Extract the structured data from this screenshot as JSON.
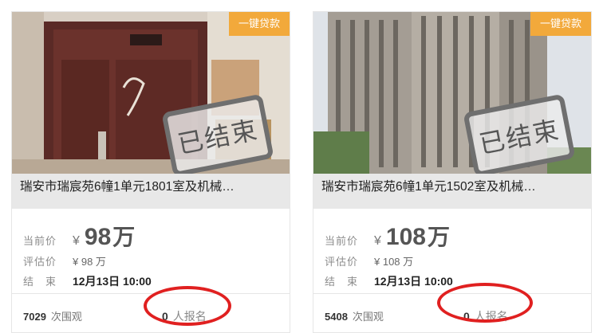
{
  "listings": [
    {
      "tag": "一键贷款",
      "stamp": "已结束",
      "title": "瑞安市瑞宸苑6幢1单元1801室及机械…",
      "price_label": "当前价",
      "price_yen": "¥",
      "price_value": "98",
      "price_unit": "万",
      "estimate_label": "评估价",
      "estimate_value": "¥ 98 万",
      "end_label": "结　束",
      "end_value": "12月13日 10:00",
      "views_count": "7029",
      "views_label": "次围观",
      "enroll_count": "0",
      "enroll_label": "人报名"
    },
    {
      "tag": "一键贷款",
      "stamp": "已结束",
      "title": "瑞安市瑞宸苑6幢1单元1502室及机械…",
      "price_label": "当前价",
      "price_yen": "¥",
      "price_value": "108",
      "price_unit": "万",
      "estimate_label": "评估价",
      "estimate_value": "¥ 108 万",
      "end_label": "结　束",
      "end_value": "12月13日 10:00",
      "views_count": "5408",
      "views_label": "次围观",
      "enroll_count": "0",
      "enroll_label": "人报名"
    }
  ],
  "colors": {
    "tag_bg": "#f2a93b",
    "highlight_circle": "#e02020"
  }
}
